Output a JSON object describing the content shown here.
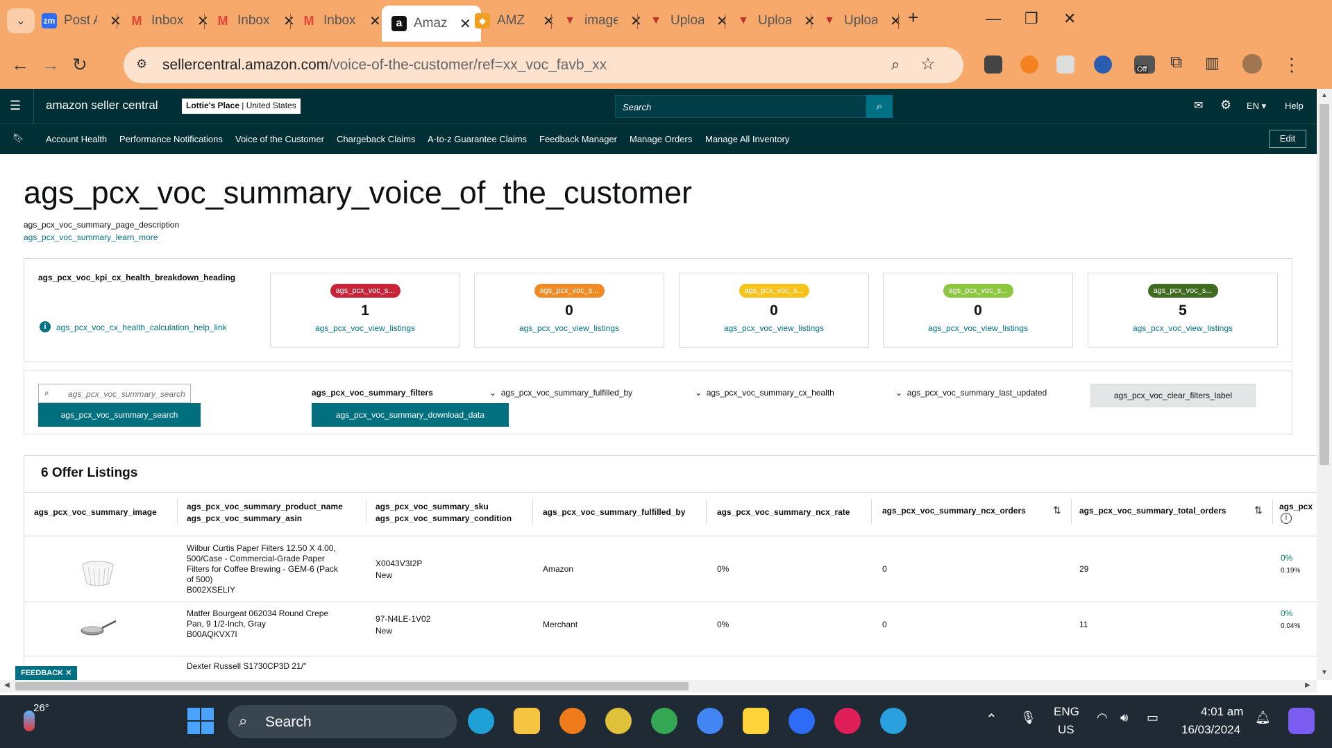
{
  "browser": {
    "tabs": [
      {
        "label": "Post A",
        "icon": "zoom-icon",
        "color": "#2d6cf6"
      },
      {
        "label": "Inbox",
        "icon": "gmail-icon",
        "color": "#ea4335"
      },
      {
        "label": "Inbox",
        "icon": "gmail-icon",
        "color": "#ea4335"
      },
      {
        "label": "Inbox",
        "icon": "gmail-icon",
        "color": "#ea4335"
      },
      {
        "label": "Amaz",
        "icon": "amazon-icon",
        "color": "#111111"
      },
      {
        "label": "AMZ",
        "icon": "amz-icon",
        "color": "#f0a020"
      },
      {
        "label": "image",
        "icon": "upload-icon",
        "color": "#c0302a"
      },
      {
        "label": "Uploa",
        "icon": "upload-icon",
        "color": "#c0302a"
      },
      {
        "label": "Uploa",
        "icon": "upload-icon",
        "color": "#c0302a"
      },
      {
        "label": "Uploa",
        "icon": "upload-icon",
        "color": "#c0302a"
      }
    ],
    "url_host": "sellercentral.amazon.com",
    "url_path": "/voice-of-the-customer/ref=xx_voc_favb_xx",
    "ext_off_badge": "Off"
  },
  "header": {
    "logo": "amazon seller central",
    "account_store": "Lottie's Place",
    "account_region": "United States",
    "search_placeholder": "Search",
    "lang": "EN",
    "help": "Help",
    "edit": "Edit"
  },
  "nav": [
    "Account Health",
    "Performance Notifications",
    "Voice of the Customer",
    "Chargeback Claims",
    "A-to-z Guarantee Claims",
    "Feedback Manager",
    "Manage Orders",
    "Manage All Inventory"
  ],
  "page": {
    "title": "ags_pcx_voc_summary_voice_of_the_customer",
    "description": "ags_pcx_voc_summary_page_description",
    "learn_more": "ags_pcx_voc_summary_learn_more"
  },
  "kpi": {
    "heading": "ags_pcx_voc_kpi_cx_health_breakdown_heading",
    "help_link": "ags_pcx_voc_cx_health_calculation_help_link",
    "cards": [
      {
        "pill": "ags_pcx_voc_s...",
        "value": "1",
        "link": "ags_pcx_voc_view_listings",
        "color": "#c7243a"
      },
      {
        "pill": "ags_pcx_voc_s...",
        "value": "0",
        "link": "ags_pcx_voc_view_listings",
        "color": "#f08a24"
      },
      {
        "pill": "ags_pcx_voc_s...",
        "value": "0",
        "link": "ags_pcx_voc_view_listings",
        "color": "#f7c21b"
      },
      {
        "pill": "ags_pcx_voc_s...",
        "value": "0",
        "link": "ags_pcx_voc_view_listings",
        "color": "#8dc63f"
      },
      {
        "pill": "ags_pcx_voc_s...",
        "value": "5",
        "link": "ags_pcx_voc_view_listings",
        "color": "#3e6b20"
      }
    ]
  },
  "filters": {
    "search_placeholder": "ags_pcx_voc_summary_search",
    "search_button": "ags_pcx_voc_summary_search",
    "label": "ags_pcx_voc_summary_filters",
    "download": "ags_pcx_voc_summary_download_data",
    "fulfilled_by": "ags_pcx_voc_summary_fulfilled_by",
    "cx_health": "ags_pcx_voc_summary_cx_health",
    "last_updated": "ags_pcx_voc_summary_last_updated",
    "clear": "ags_pcx_voc_clear_filters_label"
  },
  "listings": {
    "heading": "6 Offer Listings",
    "columns": {
      "image": "ags_pcx_voc_summary_image",
      "product_name": "ags_pcx_voc_summary_product_name",
      "asin": "ags_pcx_voc_summary_asin",
      "sku": "ags_pcx_voc_summary_sku",
      "condition": "ags_pcx_voc_summary_condition",
      "fulfilled_by": "ags_pcx_voc_summary_fulfilled_by",
      "ncx_rate": "ags_pcx_voc_summary_ncx_rate",
      "ncx_orders": "ags_pcx_voc_summary_ncx_orders",
      "total_orders": "ags_pcx_voc_summary_total_orders",
      "last": "ags_pcx"
    },
    "rows": [
      {
        "name_lines": [
          "Wilbur Curtis Paper Filters 12.50 X 4.00,",
          "500/Case - Commercial-Grade Paper",
          "Filters for Coffee Brewing - GEM-6 (Pack",
          "of 500)"
        ],
        "asin": "B002XSELIY",
        "sku": "X0043V3I2P",
        "condition": "New",
        "fulfilled_by": "Amazon",
        "ncx_rate": "0%",
        "ncx_orders": "0",
        "total_orders": "29",
        "last_a": "0%",
        "last_b": "0.19%"
      },
      {
        "name_lines": [
          "Matfer Bourgeat 062034 Round Crepe",
          "Pan, 9 1/2-Inch, Gray"
        ],
        "asin": "B00AQKVX7I",
        "sku": "97-N4LE-1V02",
        "condition": "New",
        "fulfilled_by": "Merchant",
        "ncx_rate": "0%",
        "ncx_orders": "0",
        "total_orders": "11",
        "last_a": "0%",
        "last_b": "0.04%"
      }
    ],
    "partial_row": "Dexter Russell  S1730CP3D 21/\""
  },
  "feedback": "FEEDBACK",
  "taskbar": {
    "weather": "26°",
    "search": "Search",
    "lang1": "ENG",
    "lang2": "US",
    "time": "4:01 am",
    "date": "16/03/2024"
  }
}
